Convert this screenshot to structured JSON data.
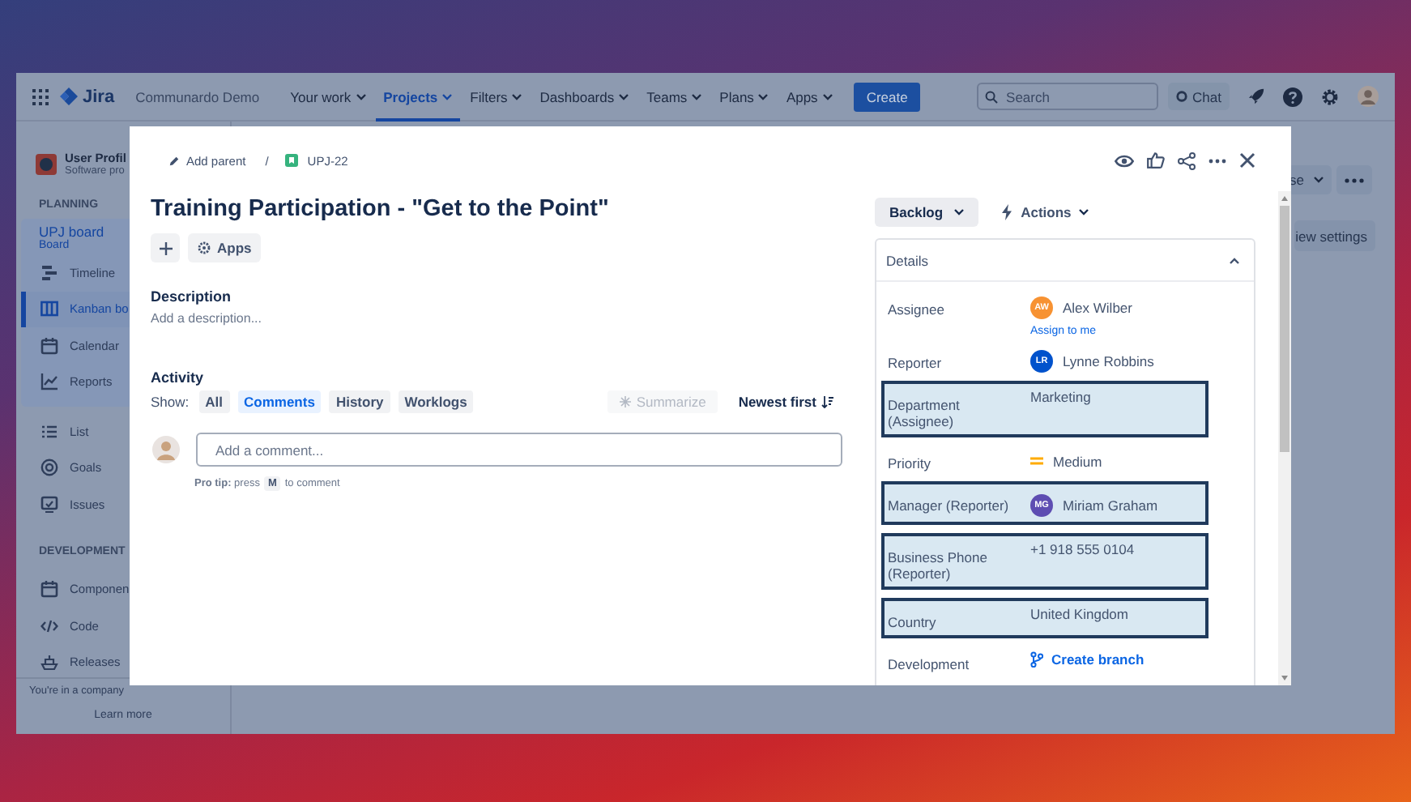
{
  "nav": {
    "product": "Jira",
    "site": "Communardo Demo",
    "menus": [
      {
        "label": "Your work",
        "selected": false
      },
      {
        "label": "Projects",
        "selected": true
      },
      {
        "label": "Filters",
        "selected": false
      },
      {
        "label": "Dashboards",
        "selected": false
      },
      {
        "label": "Teams",
        "selected": false
      },
      {
        "label": "Plans",
        "selected": false
      },
      {
        "label": "Apps",
        "selected": false
      }
    ],
    "create": "Create",
    "search": {
      "placeholder": "Search"
    },
    "chat": "Chat"
  },
  "sidebar": {
    "project": {
      "name": "User Profil",
      "type": "Software pro"
    },
    "sections": [
      {
        "heading": "PLANNING",
        "board": {
          "name": "UPJ board",
          "type": "Board"
        },
        "items": [
          {
            "label": "Timeline",
            "selected": false
          },
          {
            "label": "Kanban bo",
            "selected": true
          },
          {
            "label": "Calendar",
            "selected": false
          },
          {
            "label": "Reports",
            "selected": false
          }
        ]
      },
      {
        "items": [
          {
            "label": "List",
            "selected": false
          },
          {
            "label": "Goals",
            "selected": false
          },
          {
            "label": "Issues",
            "selected": false
          }
        ]
      },
      {
        "heading": "DEVELOPMENT",
        "items": [
          {
            "label": "Componen",
            "selected": false
          },
          {
            "label": "Code",
            "selected": false
          },
          {
            "label": "Releases",
            "selected": false
          }
        ]
      }
    ],
    "notice": "You're in a company",
    "link": "Learn more"
  },
  "board_toolbar": {
    "menu_button": "se",
    "settings_button": "iew settings"
  },
  "issue": {
    "breadcrumb": {
      "parent": "Add parent",
      "separator": "/",
      "key": "UPJ-22"
    },
    "title": "Training Participation - \"Get to the Point\"",
    "apps_button": "Apps",
    "description": {
      "heading": "Description",
      "placeholder": "Add a description..."
    },
    "activity": {
      "heading": "Activity",
      "show_label": "Show:",
      "filters": [
        {
          "label": "All",
          "selected": false
        },
        {
          "label": "Comments",
          "selected": true
        },
        {
          "label": "History",
          "selected": false
        },
        {
          "label": "Worklogs",
          "selected": false
        }
      ],
      "summarize": {
        "label": "Summarize",
        "disabled": true
      },
      "sort": "Newest first",
      "comment": {
        "placeholder": "Add a comment..."
      },
      "pro_tip": {
        "lead": "**Pro tip:** press",
        "key": "M",
        "rest": "to comment"
      }
    },
    "status": "Backlog",
    "actions": "Actions",
    "details": {
      "heading": "Details",
      "expanded": true,
      "fields": [
        {
          "kind": "person",
          "label": "Assignee",
          "value": "Alex Wilber",
          "initials": "AW",
          "color": "#f79232",
          "action": "Assign to me",
          "highlighted": false
        },
        {
          "kind": "person",
          "label": "Reporter",
          "value": "Lynne Robbins",
          "initials": "LR",
          "color": "#0052cc",
          "highlighted": false
        },
        {
          "kind": "text",
          "label": "Department (Assignee)",
          "value": "Marketing",
          "highlighted": true
        },
        {
          "kind": "priority",
          "label": "Priority",
          "value": "Medium",
          "highlighted": false
        },
        {
          "kind": "person",
          "label": "Manager (Reporter)",
          "value": "Miriam Graham",
          "initials": "MG",
          "color": "#5e4db2",
          "highlighted": true
        },
        {
          "kind": "text",
          "label": "Business Phone (Reporter)",
          "value": "+1 918 555 0104",
          "highlighted": true
        },
        {
          "kind": "text",
          "label": "Country",
          "value": "United Kingdom",
          "highlighted": true
        },
        {
          "kind": "link",
          "label": "Development",
          "value": "Create branch",
          "highlighted": false
        }
      ]
    }
  }
}
